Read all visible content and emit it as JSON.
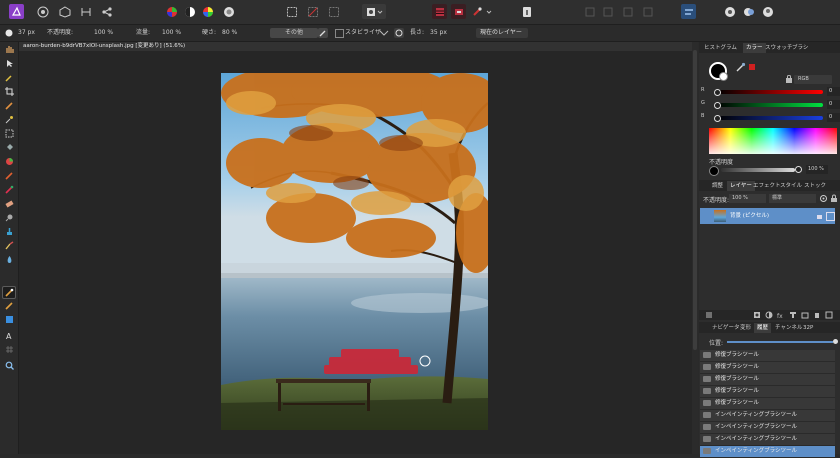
{
  "document": {
    "tab_title": "aaron-burden-b9drVB7xIOI-unsplash.jpg [変更あり] (51.6%)"
  },
  "context_toolbar": {
    "width_value": "37 px",
    "opacity_label": "不透明度:",
    "opacity_value": "100 %",
    "flow_label": "流量:",
    "flow_value": "100 %",
    "hardness_label": "硬さ:",
    "hardness_value": "80 %",
    "more_button": "その他",
    "stabilize_label": "スタビライザ",
    "length_label": "長さ:",
    "length_value": "35 px",
    "source_value": "現在のレイヤー"
  },
  "color_panel": {
    "tabs": [
      "ヒストグラム",
      "カラー",
      "スウォッチ",
      "ブラシ"
    ],
    "active_tab": "カラー",
    "mode": "RGB",
    "channels": [
      {
        "label": "R",
        "value": "0",
        "color": "#e02020"
      },
      {
        "label": "G",
        "value": "0",
        "color": "#1fbf3a"
      },
      {
        "label": "B",
        "value": "0",
        "color": "#1a3fe0"
      }
    ],
    "opacity_label": "不透明度",
    "opacity_value": "100 %"
  },
  "layers_panel": {
    "tabs": [
      "調整",
      "レイヤー",
      "エフェクト",
      "スタイル",
      "ストック"
    ],
    "active_tab": "レイヤー",
    "opacity_label": "不透明度:",
    "opacity_value": "100 %",
    "blend_mode": "標準",
    "layers": [
      {
        "name": "背景 (ピクセル)",
        "selected": true
      }
    ]
  },
  "history_panel": {
    "tabs": [
      "ナビゲータ",
      "変形",
      "履歴",
      "チャンネル",
      "32P"
    ],
    "active_tab": "履歴",
    "position_label": "位置:",
    "items": [
      {
        "label": "修復ブラシツール",
        "selected": false
      },
      {
        "label": "修復ブラシツール",
        "selected": false
      },
      {
        "label": "修復ブラシツール",
        "selected": false
      },
      {
        "label": "修復ブラシツール",
        "selected": false
      },
      {
        "label": "修復ブラシツール",
        "selected": false
      },
      {
        "label": "インペインティングブラシツール",
        "selected": false
      },
      {
        "label": "インペインティングブラシツール",
        "selected": false
      },
      {
        "label": "インペインティングブラシツール",
        "selected": false
      },
      {
        "label": "インペインティングブラシツール",
        "selected": true
      }
    ]
  },
  "colors": {
    "accent": "#5e8fc8",
    "paint_stroke": "#c82a3a"
  }
}
